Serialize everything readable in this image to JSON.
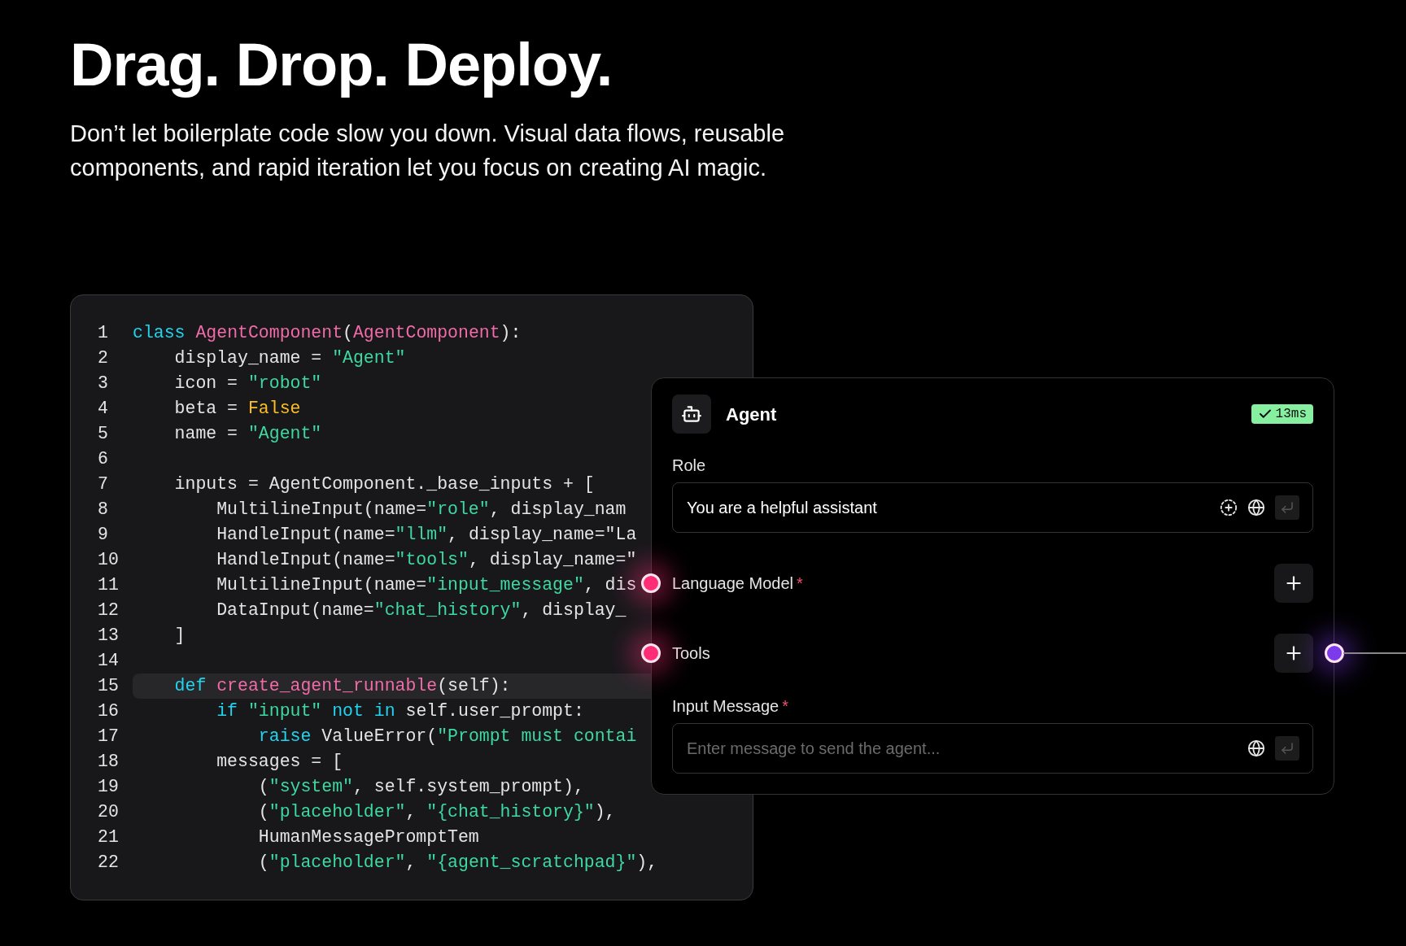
{
  "heading": "Drag. Drop. Deploy.",
  "subheading": "Don’t let boilerplate code slow you down. Visual data flows, reusable components, and rapid iteration let you focus on creating AI magic.",
  "code": {
    "lines": [
      {
        "number": "1",
        "highlighted": false,
        "tokens": [
          {
            "kind": "keyword",
            "text": "class "
          },
          {
            "kind": "name",
            "text": "AgentComponent"
          },
          {
            "kind": "plain",
            "text": "("
          },
          {
            "kind": "name",
            "text": "AgentComponent"
          },
          {
            "kind": "plain",
            "text": "):"
          }
        ]
      },
      {
        "number": "2",
        "highlighted": false,
        "tokens": [
          {
            "kind": "plain",
            "text": "    display_name = "
          },
          {
            "kind": "string",
            "text": "\"Agent\""
          }
        ]
      },
      {
        "number": "3",
        "highlighted": false,
        "tokens": [
          {
            "kind": "plain",
            "text": "    icon = "
          },
          {
            "kind": "string",
            "text": "\"robot\""
          }
        ]
      },
      {
        "number": "4",
        "highlighted": false,
        "tokens": [
          {
            "kind": "plain",
            "text": "    beta = "
          },
          {
            "kind": "constant",
            "text": "False"
          }
        ]
      },
      {
        "number": "5",
        "highlighted": false,
        "tokens": [
          {
            "kind": "plain",
            "text": "    name = "
          },
          {
            "kind": "string",
            "text": "\"Agent\""
          }
        ]
      },
      {
        "number": "6",
        "highlighted": false
      },
      {
        "number": "7",
        "highlighted": false,
        "tokens": [
          {
            "kind": "plain",
            "text": "    inputs = AgentComponent._base_inputs + ["
          }
        ]
      },
      {
        "number": "8",
        "highlighted": false,
        "tokens": [
          {
            "kind": "plain",
            "text": "        MultilineInput(name="
          },
          {
            "kind": "string",
            "text": "\"role\""
          },
          {
            "kind": "plain",
            "text": ", display_nam"
          }
        ]
      },
      {
        "number": "9",
        "highlighted": false,
        "tokens": [
          {
            "kind": "plain",
            "text": "        HandleInput(name="
          },
          {
            "kind": "string",
            "text": "\"llm\""
          },
          {
            "kind": "plain",
            "text": ", display_name=\"La"
          }
        ]
      },
      {
        "number": "10",
        "highlighted": false,
        "tokens": [
          {
            "kind": "plain",
            "text": "        HandleInput(name="
          },
          {
            "kind": "string",
            "text": "\"tools\""
          },
          {
            "kind": "plain",
            "text": ", display_name=\""
          }
        ]
      },
      {
        "number": "11",
        "highlighted": false,
        "tokens": [
          {
            "kind": "plain",
            "text": "        MultilineInput(name="
          },
          {
            "kind": "string",
            "text": "\"input_message\""
          },
          {
            "kind": "plain",
            "text": ", dis"
          }
        ]
      },
      {
        "number": "12",
        "highlighted": false,
        "tokens": [
          {
            "kind": "plain",
            "text": "        DataInput(name="
          },
          {
            "kind": "string",
            "text": "\"chat_history\""
          },
          {
            "kind": "plain",
            "text": ", display_"
          }
        ]
      },
      {
        "number": "13",
        "highlighted": false,
        "tokens": [
          {
            "kind": "plain",
            "text": "    ]"
          }
        ]
      },
      {
        "number": "14",
        "highlighted": false
      },
      {
        "number": "15",
        "highlighted": true,
        "tokens": [
          {
            "kind": "keyword",
            "text": "    def "
          },
          {
            "kind": "name",
            "text": "create_agent_runnable"
          },
          {
            "kind": "plain",
            "text": "(self):"
          }
        ]
      },
      {
        "number": "16",
        "highlighted": false,
        "tokens": [
          {
            "kind": "keyword",
            "text": "        if "
          },
          {
            "kind": "string",
            "text": "\"input\" "
          },
          {
            "kind": "keyword",
            "text": "not in "
          },
          {
            "kind": "plain",
            "text": "self.user_prompt:"
          }
        ]
      },
      {
        "number": "17",
        "highlighted": false,
        "tokens": [
          {
            "kind": "keyword",
            "text": "            raise "
          },
          {
            "kind": "plain",
            "text": "ValueError("
          },
          {
            "kind": "string",
            "text": "\"Prompt must contai"
          }
        ]
      },
      {
        "number": "18",
        "highlighted": false,
        "tokens": [
          {
            "kind": "plain",
            "text": "        messages = ["
          }
        ]
      },
      {
        "number": "19",
        "highlighted": false,
        "tokens": [
          {
            "kind": "plain",
            "text": "            ("
          },
          {
            "kind": "string",
            "text": "\"system\""
          },
          {
            "kind": "plain",
            "text": ", self.system_prompt),"
          }
        ]
      },
      {
        "number": "20",
        "highlighted": false,
        "tokens": [
          {
            "kind": "plain",
            "text": "            ("
          },
          {
            "kind": "string",
            "text": "\"placeholder\""
          },
          {
            "kind": "plain",
            "text": ", "
          },
          {
            "kind": "string",
            "text": "\"{chat_history}\""
          },
          {
            "kind": "plain",
            "text": "),"
          }
        ]
      },
      {
        "number": "21",
        "highlighted": false,
        "tokens": [
          {
            "kind": "plain",
            "text": "            HumanMessagePromptTem"
          }
        ]
      },
      {
        "number": "22",
        "highlighted": false,
        "tokens": [
          {
            "kind": "plain",
            "text": "            ("
          },
          {
            "kind": "string",
            "text": "\"placeholder\""
          },
          {
            "kind": "plain",
            "text": ", "
          },
          {
            "kind": "string",
            "text": "\"{agent_scratchpad}\""
          },
          {
            "kind": "plain",
            "text": "),"
          }
        ]
      }
    ]
  },
  "node": {
    "title": "Agent",
    "status": {
      "ok": true,
      "time": "13ms"
    },
    "fields": [
      {
        "kind": "text",
        "label": "Role",
        "value": "You are a helpful assistant",
        "variable_button": true
      },
      {
        "kind": "handle",
        "label": "Language Model",
        "required_mark": "*",
        "color": "#ff2d78"
      },
      {
        "kind": "handle",
        "label": "Tools",
        "color": "#ff2d78",
        "output": {
          "color": "#7c3aed"
        }
      },
      {
        "kind": "text",
        "label": "Input Message",
        "required_mark": "*",
        "placeholder": "Enter message to send the agent...",
        "variable_button": false
      }
    ]
  }
}
